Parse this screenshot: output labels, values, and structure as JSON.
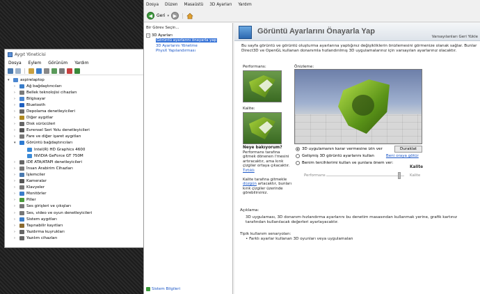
{
  "device_manager": {
    "title": "Aygıt Yöneticisi",
    "menu": [
      "Dosya",
      "Eylem",
      "Görünüm",
      "Yardım"
    ],
    "root": "aspirelaptop",
    "categories": [
      {
        "label": "Ağ bağdaştırıcıları",
        "color": "#3a7dc9",
        "expanded": false
      },
      {
        "label": "Bellek teknolojisi cihazları",
        "color": "#7a7a7a",
        "expanded": false
      },
      {
        "label": "Bilgisayar",
        "color": "#4a86d0",
        "expanded": false
      },
      {
        "label": "Bluetooth",
        "color": "#1f5fbf",
        "expanded": false
      },
      {
        "label": "Depolama denetleyicileri",
        "color": "#6a6a6a",
        "expanded": false
      },
      {
        "label": "Diğer aygıtlar",
        "color": "#b08a20",
        "expanded": false
      },
      {
        "label": "Disk sürücüleri",
        "color": "#666666",
        "expanded": false
      },
      {
        "label": "Evrensel Seri Yolu denetleyicileri",
        "color": "#555555",
        "expanded": false
      },
      {
        "label": "Fare ve diğer işaret aygıtları",
        "color": "#777777",
        "expanded": false
      },
      {
        "label": "Görüntü bağdaştırıcıları",
        "color": "#2e7bd1",
        "expanded": true
      },
      {
        "label": "Intel(R) HD Graphics 4600",
        "color": "#3a8ad8",
        "child": true
      },
      {
        "label": "NVIDIA GeForce GT 750M",
        "color": "#3a8ad8",
        "child": true
      },
      {
        "label": "IDE ATA/ATAPI denetleyicileri",
        "color": "#666666",
        "expanded": false
      },
      {
        "label": "İnsan Arabirim Cihazları",
        "color": "#777777",
        "expanded": false
      },
      {
        "label": "İşlemciler",
        "color": "#4a7ab0",
        "expanded": false
      },
      {
        "label": "Kameralar",
        "color": "#555555",
        "expanded": false
      },
      {
        "label": "Klavyeler",
        "color": "#777777",
        "expanded": false
      },
      {
        "label": "Monitörler",
        "color": "#3a7dc9",
        "expanded": false
      },
      {
        "label": "Piller",
        "color": "#4a9a3a",
        "expanded": false
      },
      {
        "label": "Ses girişleri ve çıkışları",
        "color": "#777777",
        "expanded": false
      },
      {
        "label": "Ses, video ve oyun denetleyicileri",
        "color": "#777777",
        "expanded": false
      },
      {
        "label": "Sistem aygıtları",
        "color": "#3a7dc9",
        "expanded": false
      },
      {
        "label": "Taşınabilir kayıtları",
        "color": "#8a6a30",
        "expanded": false
      },
      {
        "label": "Yazdırma kuyrukları",
        "color": "#666666",
        "expanded": false
      },
      {
        "label": "Yazılım cihazları",
        "color": "#666666",
        "expanded": false
      }
    ]
  },
  "nvidia": {
    "menu": [
      "Dosya",
      "Düzen",
      "Masaüstü",
      "3D Ayarları",
      "Yardım"
    ],
    "back_label": "Geri",
    "task_title": "Bir Görev Seçin...",
    "tree": {
      "parent": "3D Ayarları",
      "children": [
        "Görüntü ayarlarını önayarla yap",
        "3D Ayarlarını Yönetme",
        "PhysX Yapılandırması"
      ]
    },
    "sysinfo": "Sistem Bilgileri",
    "banner_title": "Görüntü Ayarlarını Önayarla Yap",
    "restore": "Varsayılanları Geri Yükle",
    "intro": "Bu sayfa görüntü ve görüntü oluşturma ayarlarına yaptığınız değişikliklerin önizlemesini görmenize olanak sağlar. Bunlar Direct3D ve OpenGL kullanan donanımla hızlandırılmış 3D uygulamalarınız için varsayılan ayarlarınız olacaktır.",
    "perf_label": "Performans:",
    "quality_label": "Kalite:",
    "preview_label": "Önizleme:",
    "pause": "Duraklat",
    "ask_title": "Neye bakıyorum?",
    "ask_text1": "Performans tarafına gitmek dönenen i'mesini artıracaktır, ama kırık çizgiler ortaya çıkacaktır.",
    "ask_link1": "Tırtıklı",
    "ask_text2": "Kalite tarafına gitmekle",
    "ask_link2": "düzgün",
    "ask_text3": "artacaktır, bunları kırık çizgiler üzerinde görebilirsiniz.",
    "options": [
      {
        "label": "3D uygulamanın karar vermesine izin ver",
        "checked": true
      },
      {
        "label": "Gelişmiş 3D görüntü ayarlarını kullan",
        "checked": false,
        "link": "Beni oraya götür"
      },
      {
        "label": "Benim tercihlerimi kullan ve şunlara önem ver:",
        "checked": false,
        "emphasis": "Kalite"
      }
    ],
    "slider": {
      "left": "Performans",
      "right": "Kalite",
      "value_fraction": 0.95
    },
    "desc_title": "Açıklama:",
    "desc_text": "3D uygulaması, 3D donanım-hızlandırma ayarlarını bu denetim masasından kullanmak yerine, grafik kartınız tarafından kullanılacak değerleri ayarlayacaktır.",
    "usage_title": "Tipik kullanım senaryoları:",
    "usage_item": "Farklı ayarlar kullanan 3D oyunları veya uygulamaları"
  }
}
